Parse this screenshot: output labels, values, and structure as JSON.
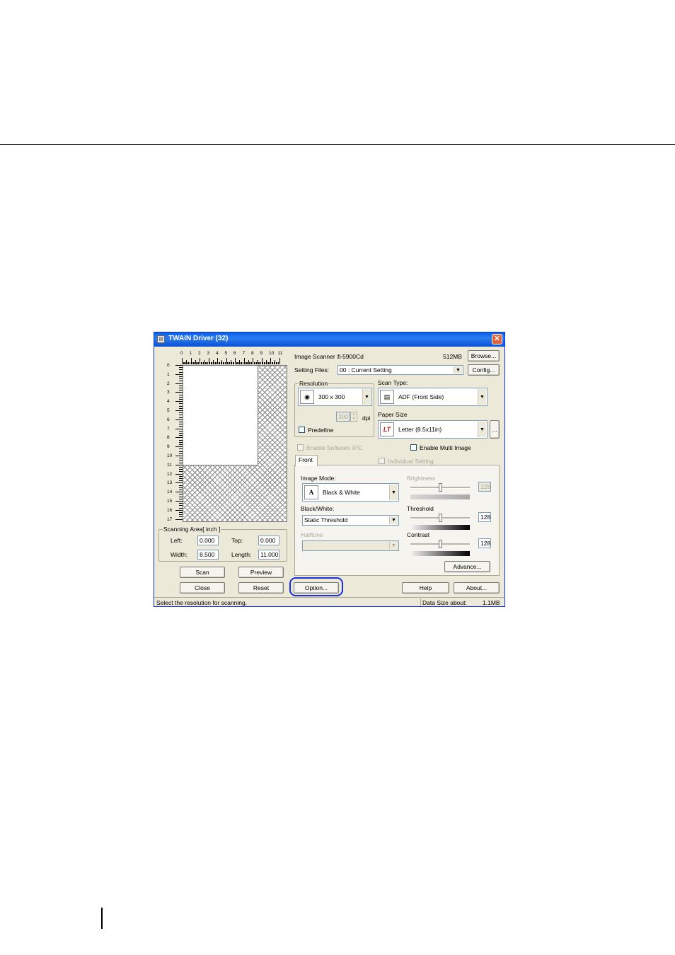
{
  "window": {
    "title": "TWAIN Driver (32)",
    "close_glyph": "✕",
    "icon": "scanner-icon"
  },
  "ruler": {
    "h_numbers": [
      "0",
      "1",
      "2",
      "3",
      "4",
      "5",
      "6",
      "7",
      "8",
      "9",
      "10",
      "11"
    ],
    "v_numbers": [
      "0",
      "1",
      "2",
      "3",
      "4",
      "5",
      "6",
      "7",
      "8",
      "9",
      "10",
      "11",
      "12",
      "13",
      "14",
      "15",
      "16",
      "17"
    ]
  },
  "scanning_area": {
    "title": "Scanning Area[ inch ]",
    "left_label": "Left:",
    "left_value": "0.000",
    "top_label": "Top:",
    "top_value": "0.000",
    "width_label": "Width:",
    "width_value": "8.500",
    "length_label": "Length:",
    "length_value": "11.000"
  },
  "buttons": {
    "scan": "Scan",
    "preview": "Preview",
    "close": "Close",
    "reset": "Reset",
    "option": "Option...",
    "help": "Help",
    "about": "About...",
    "browse": "Browse...",
    "config": "Config...",
    "advance": "Advance...",
    "paper_more": "..."
  },
  "scanner": {
    "label": "Image Scanner :",
    "name": "fi-5900Cd",
    "memory": "512MB"
  },
  "setting_files": {
    "label": "Setting Files:",
    "value": "00 : Current Setting"
  },
  "resolution": {
    "title": "Resolution",
    "value": "300 x 300",
    "dpi_value": "300",
    "dpi_label": "dpi",
    "predefine": "Predefine"
  },
  "scan_type": {
    "title": "Scan Type:",
    "value": "ADF (Front Side)"
  },
  "paper_size": {
    "title": "Paper Size",
    "value": "Letter (8.5x11in)",
    "icon_text": "LT"
  },
  "options": {
    "software_ipc": "Enable Software IPC",
    "multi_image": "Enable Multi Image",
    "individual_setting": "Individual Setting"
  },
  "tabs": {
    "front": "Front"
  },
  "image_mode": {
    "label": "Image Mode:",
    "value": "Black & White",
    "icon_text": "A"
  },
  "black_white": {
    "label": "Black/White:",
    "value": "Static Threshold"
  },
  "halftone": {
    "label": "Halftone",
    "value": ""
  },
  "sliders": {
    "brightness": {
      "label": "Brightness",
      "value": "128",
      "level": 0.5
    },
    "threshold": {
      "label": "Threshold",
      "value": "128",
      "level": 0.5
    },
    "contrast": {
      "label": "Contrast",
      "value": "128",
      "level": 0.5
    }
  },
  "status": {
    "message": "Select the resolution for scanning.",
    "data_size_label": "Data Size about:",
    "data_size_value": "1.1MB"
  },
  "colors": {
    "title_bar": "#0a5ee8",
    "highlight_ring": "#1a2fd8",
    "dialog_bg": "#ece9d8"
  }
}
